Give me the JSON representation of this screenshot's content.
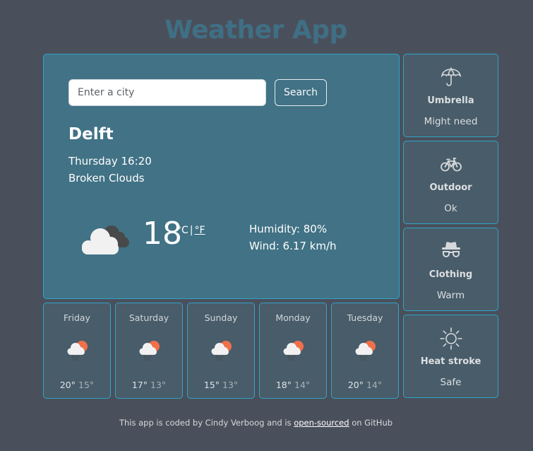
{
  "app": {
    "title": "Weather App"
  },
  "search": {
    "placeholder": "Enter a city",
    "value": "",
    "button_label": "Search"
  },
  "current": {
    "city": "Delft",
    "datetime": "Thursday 16:20",
    "description": "Broken Clouds",
    "icon": "broken-clouds-icon",
    "temperature": "18",
    "unit_c": "°C",
    "unit_separator": "|",
    "unit_f": "°F",
    "humidity": "Humidity: 80%",
    "wind": "Wind: 6.17 km/h"
  },
  "advice": [
    {
      "icon": "umbrella-icon",
      "label": "Umbrella",
      "value": "Might need"
    },
    {
      "icon": "bicycle-icon",
      "label": "Outdoor",
      "value": "Ok"
    },
    {
      "icon": "hat-glasses-icon",
      "label": "Clothing",
      "value": "Warm"
    },
    {
      "icon": "sun-icon",
      "label": "Heat stroke",
      "value": "Safe"
    }
  ],
  "forecast": [
    {
      "day": "Friday",
      "icon": "rain-sun-cloud-icon",
      "max": "20°",
      "min": "15°"
    },
    {
      "day": "Saturday",
      "icon": "rain-sun-cloud-icon",
      "max": "17°",
      "min": "13°"
    },
    {
      "day": "Sunday",
      "icon": "rain-sun-cloud-icon",
      "max": "15°",
      "min": "13°"
    },
    {
      "day": "Monday",
      "icon": "rain-sun-cloud-icon",
      "max": "18°",
      "min": "14°"
    },
    {
      "day": "Tuesday",
      "icon": "rain-sun-cloud-icon",
      "max": "20°",
      "min": "14°"
    }
  ],
  "footer": {
    "prefix": "This app is coded by Cindy Verboog and is ",
    "link_label": "open-sourced",
    "suffix": " on GitHub"
  },
  "colors": {
    "background": "#4a505b",
    "title": "#3f6f85",
    "main_card": "#417285",
    "side_card": "#485c69",
    "border": "#2fa4c8",
    "sun": "#f0704a"
  }
}
